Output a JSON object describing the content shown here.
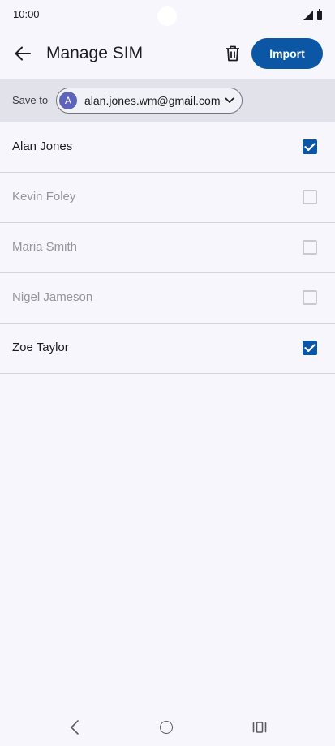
{
  "status_bar": {
    "time": "10:00"
  },
  "header": {
    "title": "Manage SIM",
    "import_label": "Import"
  },
  "save_to": {
    "label": "Save to",
    "avatar_initial": "A",
    "account": "alan.jones.wm@gmail.com"
  },
  "contacts": [
    {
      "name": "Alan Jones",
      "checked": true,
      "enabled": true
    },
    {
      "name": "Kevin Foley",
      "checked": false,
      "enabled": false
    },
    {
      "name": "Maria Smith",
      "checked": false,
      "enabled": false
    },
    {
      "name": "Nigel Jameson",
      "checked": false,
      "enabled": false
    },
    {
      "name": "Zoe Taylor",
      "checked": true,
      "enabled": true
    }
  ],
  "colors": {
    "accent": "#0b57a6",
    "background": "#f7f6fd",
    "save_bar": "#e1e2ea",
    "avatar": "#5c63b8"
  }
}
